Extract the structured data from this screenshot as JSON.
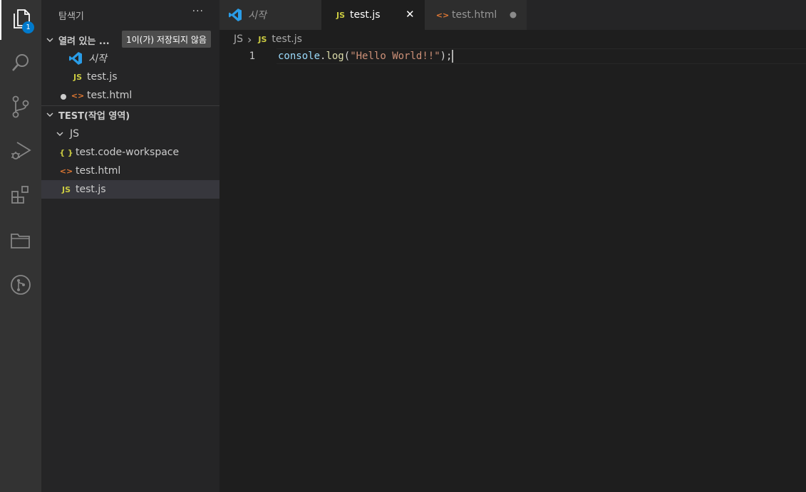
{
  "activity_bar": {
    "items": [
      {
        "icon": "explorer-icon",
        "active": true,
        "badge": "1"
      },
      {
        "icon": "search-icon"
      },
      {
        "icon": "source-control-icon"
      },
      {
        "icon": "run-debug-icon"
      },
      {
        "icon": "extensions-icon"
      },
      {
        "icon": "remote-explorer-icon"
      },
      {
        "icon": "git-graph-icon"
      }
    ]
  },
  "sidebar": {
    "title": "탐색기",
    "more_label": "···",
    "open_editors": {
      "header": "열려 있는 ...",
      "unsaved_tag": "1이(가) 저장되지 않음",
      "items": [
        {
          "label": "시작",
          "icon": "vscode-logo-icon"
        },
        {
          "label": "test.js",
          "icon": "js-file-icon",
          "glyph": "JS"
        },
        {
          "label": "test.html",
          "icon": "html-file-icon",
          "glyph": "<>",
          "dirty": true
        }
      ]
    },
    "workspace": {
      "header": "TEST(작업 영역)",
      "folder": "JS",
      "items": [
        {
          "label": "test.code-workspace",
          "glyph": "{ }"
        },
        {
          "label": "test.html",
          "glyph": "<>"
        },
        {
          "label": "test.js",
          "glyph": "JS",
          "selected": true
        }
      ]
    }
  },
  "tabs": [
    {
      "label": "시작",
      "state": "inactive"
    },
    {
      "label": "test.js",
      "glyph": "JS",
      "state": "active",
      "close": "✕"
    },
    {
      "label": "test.html",
      "glyph": "<>",
      "state": "inactive",
      "dirty": true
    }
  ],
  "breadcrumb": {
    "folder": "JS",
    "separator": "›",
    "file_glyph": "JS",
    "file": "test.js"
  },
  "editor": {
    "line_number": "1",
    "tokens": {
      "obj": "console",
      "dot": ".",
      "fn": "log",
      "open": "(",
      "str": "\"Hello World!!\"",
      "close": ");"
    }
  },
  "colors": {
    "accent": "#007acc",
    "js": "#cbcb41",
    "html": "#e37933",
    "string": "#ce9178",
    "identifier": "#9cdcfe",
    "function": "#dcdcaa"
  }
}
